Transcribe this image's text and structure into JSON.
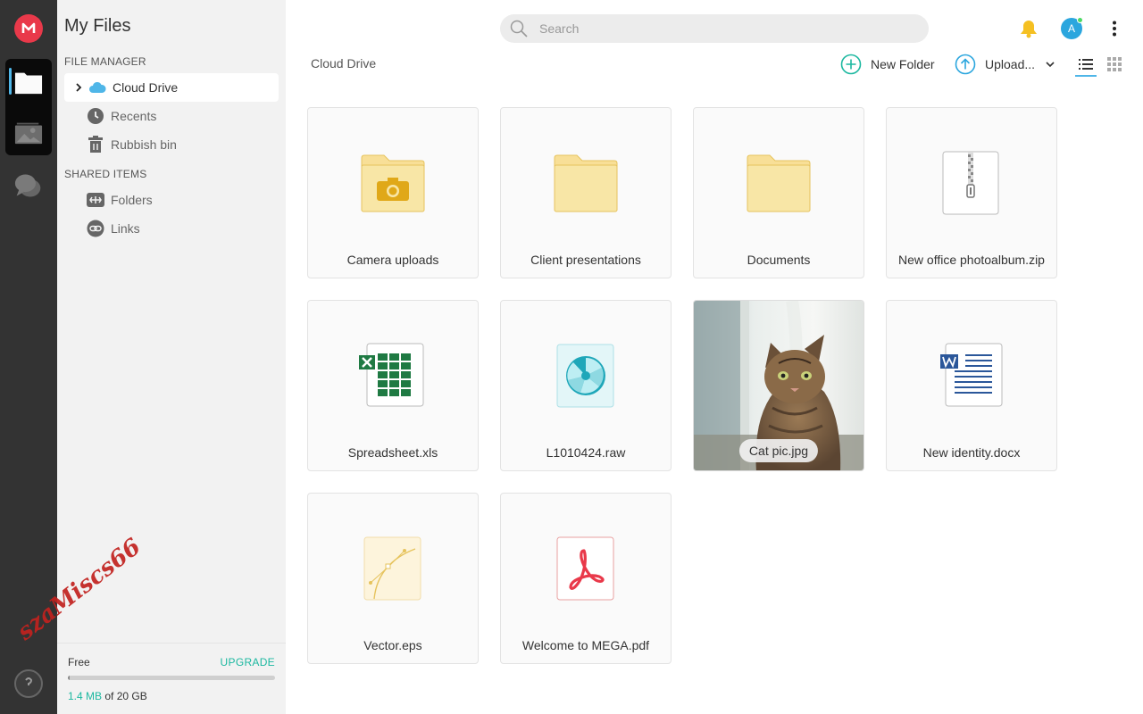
{
  "app": {
    "title": "My Files",
    "brand_color": "#e9394a",
    "accent_color": "#1cb8a0"
  },
  "sidebar": {
    "sections": [
      {
        "label": "FILE MANAGER",
        "items": [
          {
            "label": "Cloud Drive",
            "icon": "cloud-icon",
            "active": true
          },
          {
            "label": "Recents",
            "icon": "clock-icon"
          },
          {
            "label": "Rubbish bin",
            "icon": "trash-icon"
          }
        ]
      },
      {
        "label": "SHARED ITEMS",
        "items": [
          {
            "label": "Folders",
            "icon": "shared-folder-icon"
          },
          {
            "label": "Links",
            "icon": "link-icon"
          }
        ]
      }
    ],
    "storage": {
      "plan": "Free",
      "upgrade_label": "UPGRADE",
      "used": "1.4 MB",
      "total_text": " of 20 GB",
      "used_fraction": 0.01
    }
  },
  "watermark": "szaMiscs66",
  "search": {
    "placeholder": "Search",
    "value": ""
  },
  "toolbar": {
    "breadcrumb": "Cloud Drive",
    "new_folder_label": "New Folder",
    "upload_label": "Upload...",
    "view_mode": "list"
  },
  "user": {
    "avatar_initial": "A"
  },
  "files": [
    {
      "name": "Camera uploads",
      "type": "camera-folder"
    },
    {
      "name": "Client presentations",
      "type": "folder"
    },
    {
      "name": "Documents",
      "type": "folder"
    },
    {
      "name": "New office photoalbum.zip",
      "type": "zip"
    },
    {
      "name": "Spreadsheet.xls",
      "type": "excel"
    },
    {
      "name": "L1010424.raw",
      "type": "raw"
    },
    {
      "name": "Cat pic.jpg",
      "type": "image"
    },
    {
      "name": "New identity.docx",
      "type": "word"
    },
    {
      "name": "Vector.eps",
      "type": "vector"
    },
    {
      "name": "Welcome to MEGA.pdf",
      "type": "pdf"
    }
  ]
}
